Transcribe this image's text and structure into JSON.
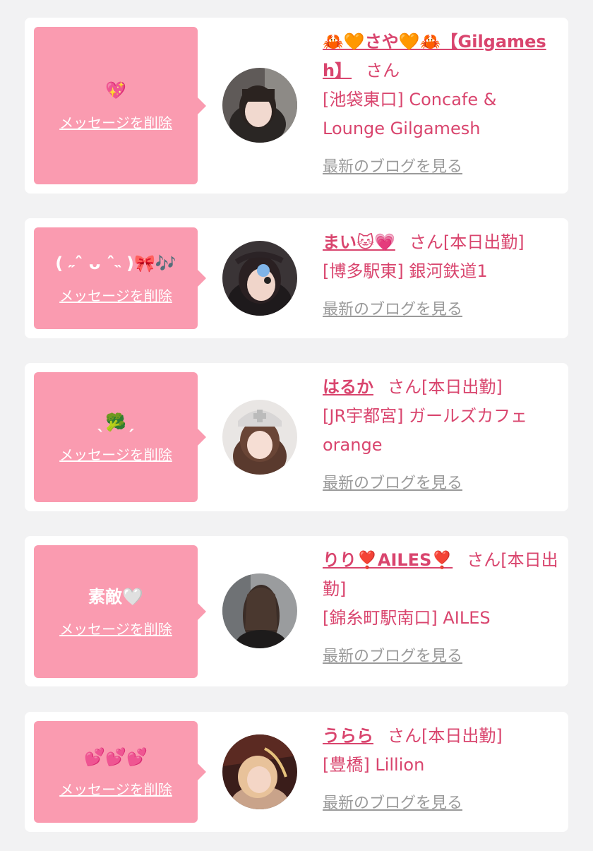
{
  "messages": [
    {
      "bubble_text": "💖",
      "delete_label": "メッセージを削除",
      "cast_name": "🦀🧡さや🧡🦀【Gilgamesh】",
      "honorific": "さん",
      "status": "",
      "shop": "[池袋東口] Concafe & Lounge Gilgamesh",
      "blog_label": "最新のブログを見る",
      "avatar_icon": "avatar-photo"
    },
    {
      "bubble_text": "( ˶ˆ ᴗ ˆ˵ )🎀🎶",
      "delete_label": "メッセージを削除",
      "cast_name": "まい🐱💗",
      "honorific": "さん",
      "status": "[本日出勤]",
      "shop": "[博多駅東] 銀河鉄道1",
      "blog_label": "最新のブログを見る",
      "avatar_icon": "avatar-photo"
    },
    {
      "bubble_text": "ˎ🥦ˏ",
      "delete_label": "メッセージを削除",
      "cast_name": "はるか",
      "honorific": "さん",
      "status": "[本日出勤]",
      "shop": "[JR宇都宮] ガールズカフェ orange",
      "blog_label": "最新のブログを見る",
      "avatar_icon": "avatar-photo"
    },
    {
      "bubble_text": "素敵🤍",
      "delete_label": "メッセージを削除",
      "cast_name": "りり❣️AILES❣️",
      "honorific": "さん",
      "status": "[本日出勤]",
      "shop": "[錦糸町駅南口] AILES",
      "blog_label": "最新のブログを見る",
      "avatar_icon": "avatar-photo"
    },
    {
      "bubble_text": "💕💕💕",
      "delete_label": "メッセージを削除",
      "cast_name": "うらら",
      "honorific": "さん",
      "status": "[本日出勤]",
      "shop": "[豊橋] Lillion",
      "blog_label": "最新のブログを見る",
      "avatar_icon": "avatar-photo"
    }
  ],
  "colors": {
    "page_background": "#f2f2f3",
    "card_background": "#ffffff",
    "bubble_background": "#fa9bb0",
    "name_text": "#d9456e",
    "blog_link": "#9a9a9a"
  }
}
